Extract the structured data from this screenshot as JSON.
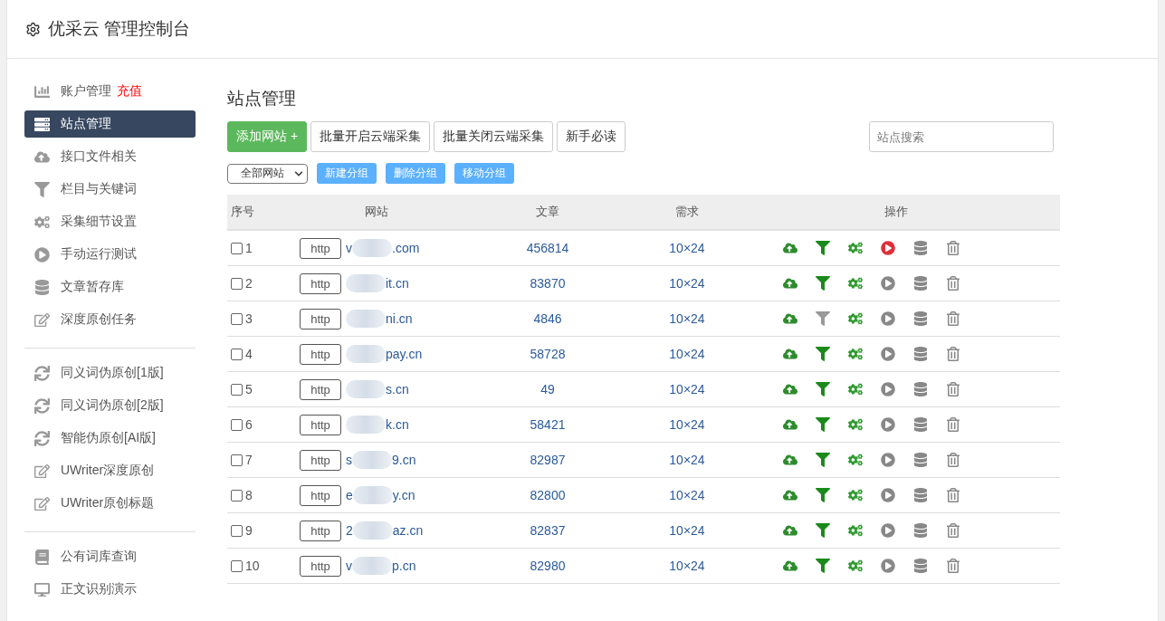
{
  "header": {
    "title": "优采云 管理控制台"
  },
  "sidebar": {
    "groups": [
      {
        "items": [
          {
            "kind": "chart",
            "label": "账户管理",
            "badge": "充值",
            "selected": false
          },
          {
            "kind": "server",
            "label": "站点管理",
            "selected": true
          },
          {
            "kind": "cloud",
            "label": "接口文件相关",
            "selected": false
          },
          {
            "kind": "filter",
            "label": "栏目与关键词",
            "selected": false
          },
          {
            "kind": "gears",
            "label": "采集细节设置",
            "selected": false
          },
          {
            "kind": "play",
            "label": "手动运行测试",
            "selected": false
          },
          {
            "kind": "database",
            "label": "文章暂存库",
            "selected": false
          },
          {
            "kind": "edit",
            "label": "深度原创任务",
            "selected": false
          }
        ]
      },
      {
        "items": [
          {
            "kind": "sync",
            "label": "同义词伪原创[1版]",
            "selected": false
          },
          {
            "kind": "sync",
            "label": "同义词伪原创[2版]",
            "selected": false
          },
          {
            "kind": "sync",
            "label": "智能伪原创[AI版]",
            "selected": false
          },
          {
            "kind": "edit",
            "label": "UWriter深度原创",
            "selected": false
          },
          {
            "kind": "edit",
            "label": "UWriter原创标题",
            "selected": false
          }
        ]
      },
      {
        "items": [
          {
            "kind": "book",
            "label": "公有词库查询",
            "selected": false
          },
          {
            "kind": "desktop",
            "label": "正文识别演示",
            "selected": false
          }
        ]
      }
    ]
  },
  "main": {
    "title": "站点管理",
    "toolbar": {
      "buttons": [
        {
          "kind": "primary",
          "label": "添加网站 +"
        },
        {
          "kind": "default",
          "label": "批量开启云端采集"
        },
        {
          "kind": "default",
          "label": "批量关闭云端采集"
        },
        {
          "kind": "default",
          "label": "新手必读"
        }
      ],
      "search": {
        "placeholder": "站点搜索"
      }
    },
    "group_select": {
      "value": "全部网站"
    },
    "group_buttons": [
      "新建分组",
      "删除分组",
      "移动分组"
    ],
    "table": {
      "columns": [
        "序号",
        "网站",
        "文章",
        "需求",
        "操作"
      ],
      "rows": [
        {
          "index": "1",
          "checked": false,
          "protocol": "http",
          "domain_start": "v",
          "domain_end": ".com",
          "articles": "456814",
          "demand": "10×24",
          "filter_on": true,
          "running": true
        },
        {
          "index": "2",
          "checked": false,
          "protocol": "http",
          "domain_end": "it.cn",
          "articles": "83870",
          "demand": "10×24",
          "filter_on": true,
          "running": false
        },
        {
          "index": "3",
          "checked": false,
          "protocol": "http",
          "domain_end": "ni.cn",
          "articles": "4846",
          "demand": "10×24",
          "filter_on": false,
          "running": false
        },
        {
          "index": "4",
          "checked": false,
          "protocol": "http",
          "domain_end": "pay.cn",
          "articles": "58728",
          "demand": "10×24",
          "filter_on": true,
          "running": false
        },
        {
          "index": "5",
          "checked": false,
          "protocol": "http",
          "domain_end": "s.cn",
          "articles": "49",
          "demand": "10×24",
          "filter_on": true,
          "running": false
        },
        {
          "index": "6",
          "checked": false,
          "protocol": "http",
          "domain_end": "k.cn",
          "articles": "58421",
          "demand": "10×24",
          "filter_on": true,
          "running": false
        },
        {
          "index": "7",
          "checked": false,
          "protocol": "http",
          "domain_start": "s",
          "domain_end": "9.cn",
          "articles": "82987",
          "demand": "10×24",
          "filter_on": true,
          "running": false
        },
        {
          "index": "8",
          "checked": false,
          "protocol": "http",
          "domain_start": "e",
          "domain_end": "y.cn",
          "articles": "82800",
          "demand": "10×24",
          "filter_on": true,
          "running": false
        },
        {
          "index": "9",
          "checked": false,
          "protocol": "http",
          "domain_start": "2",
          "domain_end": "az.cn",
          "articles": "82837",
          "demand": "10×24",
          "filter_on": true,
          "running": false
        },
        {
          "index": "10",
          "checked": false,
          "protocol": "http",
          "domain_start": "v",
          "domain_end": "p.cn",
          "articles": "82980",
          "demand": "10×24",
          "filter_on": true,
          "running": false
        }
      ]
    }
  }
}
